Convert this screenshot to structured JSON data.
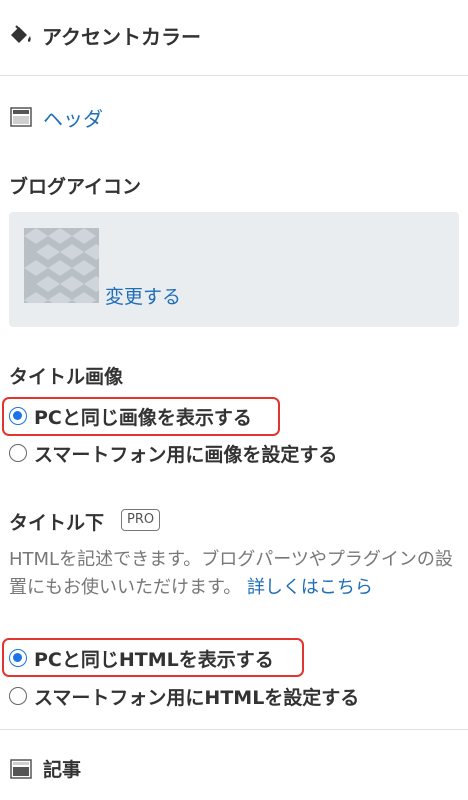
{
  "accent": {
    "label": "アクセントカラー",
    "icon": "paint-bucket-icon"
  },
  "header_section": {
    "label": "ヘッダ",
    "icon": "layout-header-icon"
  },
  "blog_icon": {
    "title": "ブログアイコン",
    "change_label": "変更する"
  },
  "title_image": {
    "title": "タイトル画像",
    "options": [
      {
        "label": "PCと同じ画像を表示する",
        "checked": true
      },
      {
        "label": "スマートフォン用に画像を設定する",
        "checked": false
      }
    ]
  },
  "title_below": {
    "title": "タイトル下",
    "badge": "PRO",
    "description": "HTMLを記述できます。ブログパーツやプラグインの設置にもお使いいただけます。",
    "details_link": "詳しくはこちら",
    "options": [
      {
        "label": "PCと同じHTMLを表示する",
        "checked": true
      },
      {
        "label": "スマートフォン用にHTMLを設定する",
        "checked": false
      }
    ]
  },
  "article_section": {
    "label": "記事",
    "icon": "layout-article-icon"
  },
  "colors": {
    "link": "#1f6fb8",
    "radio": "#1a73e8",
    "highlight": "#e3342f"
  }
}
